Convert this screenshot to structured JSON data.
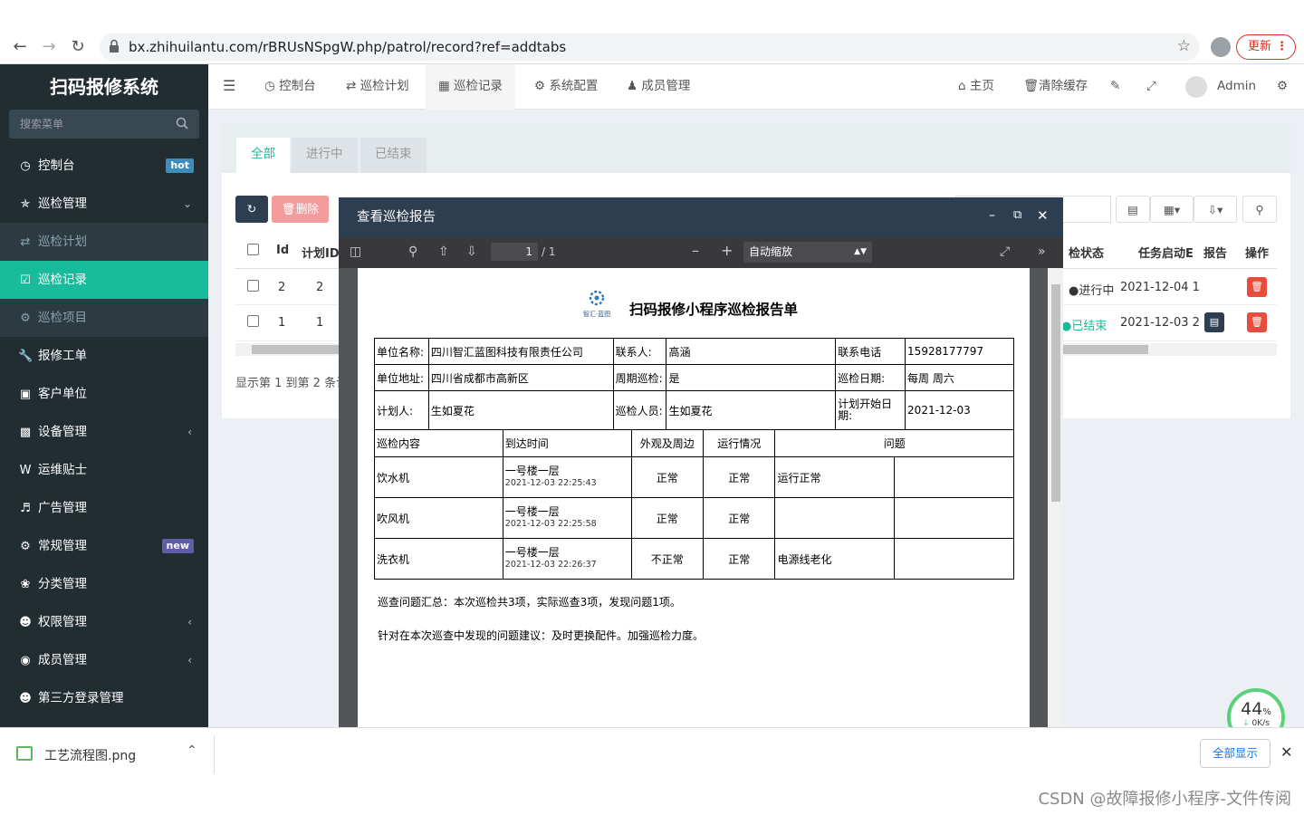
{
  "browser": {
    "url": "bx.zhihuilantu.com/rBRUsNSpgW.php/patrol/record?ref=addtabs",
    "update_label": "更新"
  },
  "sidebar": {
    "brand": "扫码报修系统",
    "search_placeholder": "搜索菜单",
    "items": [
      {
        "label": "控制台",
        "icon": "dashboard-icon",
        "badge": "hot",
        "badge_color": "#3c8dbc"
      },
      {
        "label": "巡检管理",
        "icon": "walk-icon",
        "expanded": true
      },
      {
        "label": "巡检计划",
        "icon": "shuffle-icon",
        "sub": true
      },
      {
        "label": "巡检记录",
        "icon": "calendar-check-icon",
        "sub": true,
        "active": true
      },
      {
        "label": "巡检项目",
        "icon": "gears-icon",
        "sub": true
      },
      {
        "label": "报修工单",
        "icon": "wrench-icon"
      },
      {
        "label": "客户单位",
        "icon": "address-book-icon"
      },
      {
        "label": "设备管理",
        "icon": "cubes-icon",
        "collapsible": true
      },
      {
        "label": "运维贴士",
        "icon": "wordpress-icon"
      },
      {
        "label": "广告管理",
        "icon": "volume-icon"
      },
      {
        "label": "常规管理",
        "icon": "cogs-icon",
        "badge": "new",
        "badge_color": "#605ca8"
      },
      {
        "label": "分类管理",
        "icon": "leaf-icon"
      },
      {
        "label": "权限管理",
        "icon": "group-icon",
        "collapsible": true
      },
      {
        "label": "成员管理",
        "icon": "user-circle-icon",
        "collapsible": true
      },
      {
        "label": "第三方登录管理",
        "icon": "users-icon"
      }
    ]
  },
  "topnav": {
    "items": [
      {
        "label": "控制台",
        "icon": "dashboard-icon"
      },
      {
        "label": "巡检计划",
        "icon": "shuffle-icon"
      },
      {
        "label": "巡检记录",
        "icon": "calendar-icon",
        "active": true
      },
      {
        "label": "系统配置",
        "icon": "gear-icon"
      },
      {
        "label": "成员管理",
        "icon": "user-icon"
      }
    ],
    "home_label": "主页",
    "clear_cache_label": "清除缓存",
    "user": "Admin"
  },
  "main": {
    "tabs": [
      "全部",
      "进行中",
      "已结束"
    ],
    "delete_label": "删除",
    "table_headers": {
      "id": "Id",
      "plan_id": "计划ID",
      "status": "检状态",
      "start": "任务启动E",
      "report": "报告",
      "action": "操作"
    },
    "rows": [
      {
        "id": "2",
        "plan_id": "2",
        "status": "进行中",
        "start": "2021-12-04 1"
      },
      {
        "id": "1",
        "plan_id": "1",
        "status": "已结束",
        "start": "2021-12-03 2"
      }
    ],
    "pagination_text": "显示第 1 到第 2 条记"
  },
  "modal": {
    "title": "查看巡检报告",
    "pdf": {
      "page_current": "1",
      "page_total": "/ 1",
      "zoom": "自动缩放",
      "logo_text": "智汇·蓝图",
      "report_title": "扫码报修小程序巡检报告单",
      "info": {
        "unit_name_label": "单位名称:",
        "unit_name": "四川智汇蓝图科技有限责任公司",
        "contact_label": "联系人:",
        "contact": "高涵",
        "phone_label": "联系电话",
        "phone": "15928177797",
        "address_label": "单位地址:",
        "address": "四川省成都市高新区",
        "periodic_label": "周期巡检:",
        "periodic": "是",
        "date_label": "巡检日期:",
        "date": "每周 周六",
        "planner_label": "计划人:",
        "planner": "生如夏花",
        "inspector_label": "巡检人员:",
        "inspector": "生如夏花",
        "plan_start_label": "计划开始日期:",
        "plan_start": "2021-12-03"
      },
      "headers": [
        "巡检内容",
        "到达时间",
        "外观及周边",
        "运行情况",
        "问题"
      ],
      "items": [
        {
          "name": "饮水机",
          "location": "一号楼一层",
          "time": "2021-12-03 22:25:43",
          "appearance": "正常",
          "running": "正常",
          "issue": "运行正常"
        },
        {
          "name": "吹风机",
          "location": "一号楼一层",
          "time": "2021-12-03 22:25:58",
          "appearance": "正常",
          "running": "正常",
          "issue": ""
        },
        {
          "name": "洗衣机",
          "location": "一号楼一层",
          "time": "2021-12-03 22:26:37",
          "appearance": "不正常",
          "running": "正常",
          "issue": "电源线老化"
        }
      ],
      "summary": "巡查问题汇总：本次巡检共3项，实际巡查3项，发现问题1项。",
      "suggestion": "针对在本次巡查中发现的问题建议：及时更换配件。加强巡检力度。"
    }
  },
  "download_bar": {
    "file_name": "工艺流程图.png",
    "show_all": "全部显示"
  },
  "speed_widget": {
    "percent": "44",
    "unit": "%",
    "rate": "0K/s"
  },
  "watermark": "CSDN @故障报修小程序-文件传阅"
}
